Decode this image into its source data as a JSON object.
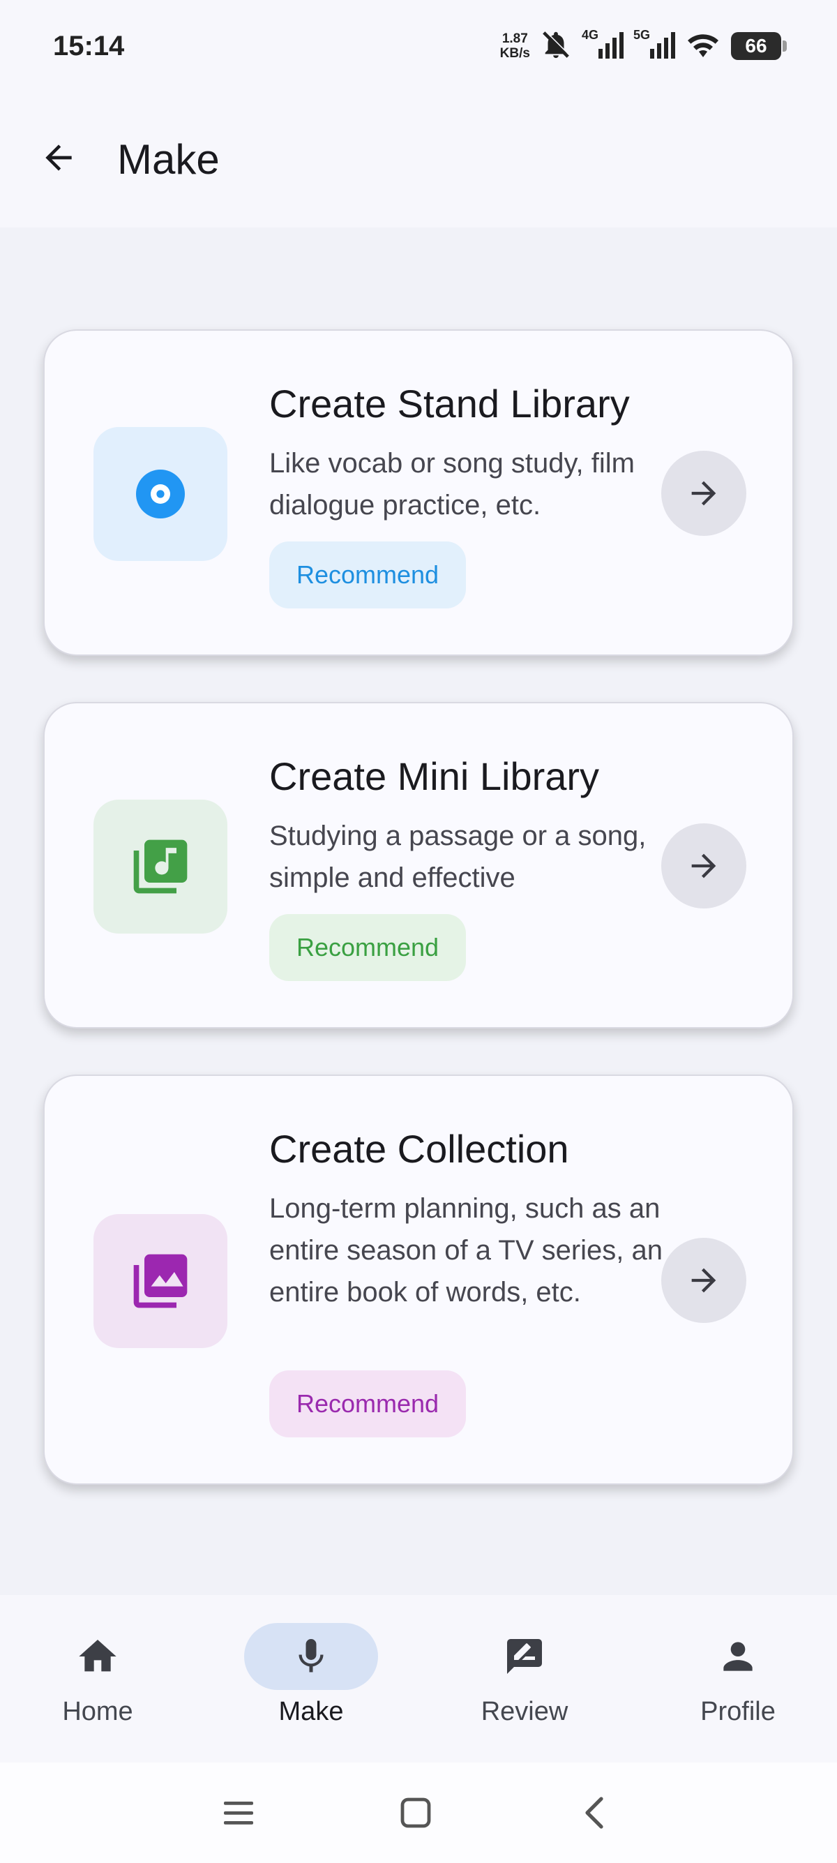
{
  "status_bar": {
    "time": "15:14",
    "net_speed_value": "1.87",
    "net_speed_unit": "KB/s",
    "net_type_1": "4G",
    "net_type_2": "5G",
    "battery": "66"
  },
  "app_bar": {
    "title": "Make",
    "back_icon": "arrow-back-icon"
  },
  "cards": [
    {
      "title": "Create Stand Library",
      "description": "Like vocab or song study, film dialogue practice, etc.",
      "badge": "Recommend",
      "icon": "disc-icon",
      "accent": "#2196f3",
      "icon_bg": "#e1effd",
      "badge_bg": "#e2f0fc",
      "badge_color": "#1e8fe0"
    },
    {
      "title": "Create Mini Library",
      "description": "Studying a passage or a song, simple and effective",
      "badge": "Recommend",
      "icon": "music-library-icon",
      "accent": "#43a047",
      "icon_bg": "#e5f1e8",
      "badge_bg": "#e5f3e6",
      "badge_color": "#3aa042"
    },
    {
      "title": "Create Collection",
      "description": "Long-term planning, such as an entire season of a TV series, an entire book of words, etc.",
      "badge": "Recommend",
      "icon": "photo-library-icon",
      "accent": "#9c27b0",
      "icon_bg": "#f1e3f4",
      "badge_bg": "#f4e2f5",
      "badge_color": "#9a2aae"
    }
  ],
  "bottom_nav": {
    "items": [
      {
        "label": "Home",
        "icon": "home-icon",
        "active": false
      },
      {
        "label": "Make",
        "icon": "mic-icon",
        "active": true
      },
      {
        "label": "Review",
        "icon": "edit-note-icon",
        "active": false
      },
      {
        "label": "Profile",
        "icon": "person-icon",
        "active": false
      }
    ]
  },
  "system_nav": {
    "buttons": [
      "menu-icon",
      "home-square-icon",
      "back-chevron-icon"
    ]
  }
}
